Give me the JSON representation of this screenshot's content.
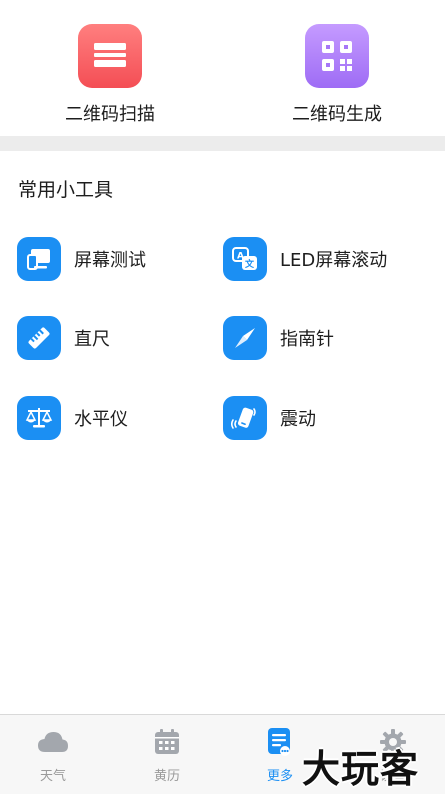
{
  "quick": {
    "scan_label": "二维码扫描",
    "generate_label": "二维码生成"
  },
  "tools": {
    "section_title": "常用小工具",
    "items": [
      {
        "label": "屏幕测试",
        "icon": "screen-test-icon"
      },
      {
        "label": "LED屏幕滚动",
        "icon": "translate-icon"
      },
      {
        "label": "直尺",
        "icon": "ruler-icon"
      },
      {
        "label": "指南针",
        "icon": "compass-icon"
      },
      {
        "label": "水平仪",
        "icon": "balance-scale-icon"
      },
      {
        "label": "震动",
        "icon": "vibration-icon"
      }
    ]
  },
  "tabbar": {
    "tabs": [
      {
        "label": "天气",
        "icon": "cloud-icon",
        "active": false
      },
      {
        "label": "黄历",
        "icon": "calendar-icon",
        "active": false
      },
      {
        "label": "更多",
        "icon": "document-list-icon",
        "active": true
      },
      {
        "label": "设置",
        "icon": "gear-icon",
        "active": false
      }
    ]
  },
  "watermark": "大玩客",
  "colors": {
    "accent": "#1b8ff3",
    "scan_gradient": [
      "#ff7f7f",
      "#f44e55"
    ],
    "generate_gradient": [
      "#c59bff",
      "#9e6cf5"
    ],
    "inactive_tab": "#9a9a9a"
  }
}
